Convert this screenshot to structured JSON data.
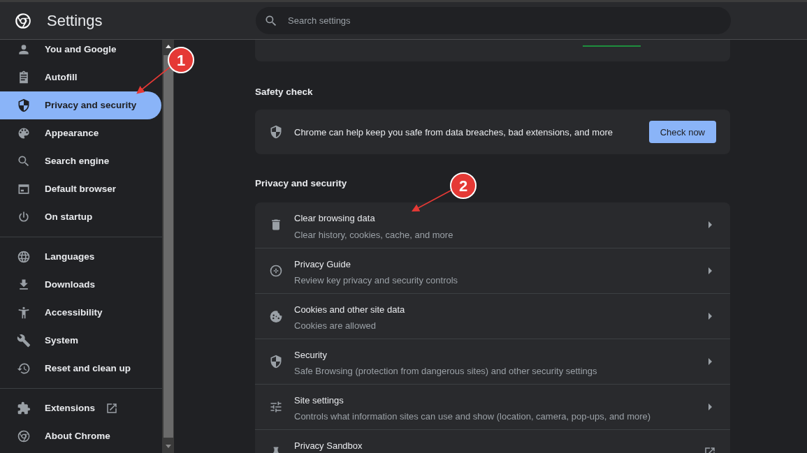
{
  "header": {
    "title": "Settings",
    "search": {
      "placeholder": "Search settings"
    }
  },
  "sidebar": {
    "groups": [
      [
        {
          "label": "You and Google",
          "selected": false
        },
        {
          "label": "Autofill",
          "selected": false
        },
        {
          "label": "Privacy and security",
          "selected": true
        },
        {
          "label": "Appearance",
          "selected": false
        },
        {
          "label": "Search engine",
          "selected": false
        },
        {
          "label": "Default browser",
          "selected": false
        },
        {
          "label": "On startup",
          "selected": false
        }
      ],
      [
        {
          "label": "Languages",
          "selected": false
        },
        {
          "label": "Downloads",
          "selected": false
        },
        {
          "label": "Accessibility",
          "selected": false
        },
        {
          "label": "System",
          "selected": false
        },
        {
          "label": "Reset and clean up",
          "selected": false
        }
      ],
      [
        {
          "label": "Extensions",
          "selected": false,
          "external": true
        },
        {
          "label": "About Chrome",
          "selected": false
        }
      ]
    ]
  },
  "safety_check": {
    "heading": "Safety check",
    "text": "Chrome can help keep you safe from data breaches, bad extensions, and more",
    "button": "Check now"
  },
  "privacy": {
    "heading": "Privacy and security",
    "rows": [
      {
        "kind": "subpage",
        "title": "Clear browsing data",
        "subtitle": "Clear history, cookies, cache, and more"
      },
      {
        "kind": "subpage",
        "title": "Privacy Guide",
        "subtitle": "Review key privacy and security controls"
      },
      {
        "kind": "subpage",
        "title": "Cookies and other site data",
        "subtitle": "Cookies are allowed"
      },
      {
        "kind": "subpage",
        "title": "Security",
        "subtitle": "Safe Browsing (protection from dangerous sites) and other security settings"
      },
      {
        "kind": "subpage",
        "title": "Site settings",
        "subtitle": "Controls what information sites can use and show (location, camera, pop-ups, and more)"
      },
      {
        "kind": "external",
        "title": "Privacy Sandbox"
      }
    ]
  },
  "annotations": [
    {
      "label": "1"
    },
    {
      "label": "2"
    }
  ]
}
